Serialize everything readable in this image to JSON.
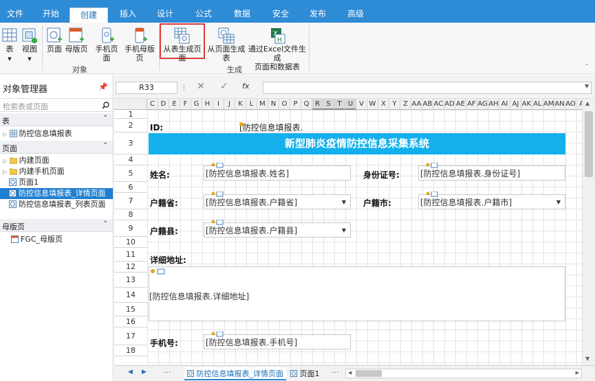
{
  "ribbon": {
    "tabs": [
      "文件",
      "开始",
      "创建",
      "插入",
      "设计",
      "公式",
      "数据",
      "安全",
      "发布",
      "高级"
    ],
    "active_tab": "创建",
    "buttons": {
      "table": "表",
      "view": "视图",
      "page": "页面",
      "master_page": "母版页",
      "mobile_page": "手机页面",
      "mobile_master_page": "手机母版页",
      "page_from_table": "从表生成页面",
      "table_from_page": "从页面生成表",
      "from_excel_line1": "通过Excel文件生成",
      "from_excel_line2": "页面和数据表"
    },
    "group_labels": {
      "objects": "对象",
      "generate": "生成"
    }
  },
  "left_panel": {
    "title": "对象管理器",
    "pin_icon": "pin-icon",
    "search_placeholder": "检索表或页面",
    "sections": {
      "tables": "表",
      "pages": "页面",
      "master_pages": "母版页"
    },
    "table_items": [
      "防控信息填报表"
    ],
    "page_items": [
      "内建页面",
      "内建手机页面",
      "页面1",
      "防控信息填报表_详情页面",
      "防控信息填报表_列表页面"
    ],
    "selected_page": "防控信息填报表_详情页面",
    "master_items": [
      "FGC_母版页"
    ]
  },
  "formula_bar": {
    "name_box": "R33",
    "fx": "fx"
  },
  "sheet": {
    "columns": [
      "C",
      "D",
      "E",
      "F",
      "G",
      "H",
      "I",
      "J",
      "K",
      "L",
      "M",
      "N",
      "O",
      "P",
      "Q",
      "R",
      "S",
      "T",
      "U",
      "V",
      "W",
      "X",
      "Y",
      "Z",
      "AA",
      "AB",
      "AC",
      "AD",
      "AE",
      "AF",
      "AG",
      "AH",
      "AI",
      "AJ",
      "AK",
      "AL",
      "AM",
      "AN",
      "AO",
      "A"
    ],
    "selected_columns": [
      "R",
      "S",
      "T",
      "U"
    ],
    "rows": [
      "1",
      "2",
      "3",
      "4",
      "5",
      "6",
      "7",
      "8",
      "9",
      "10",
      "11",
      "12",
      "13",
      "14",
      "15",
      "16",
      "17",
      "18"
    ],
    "id_label": "ID:",
    "id_binding": "[防控信息填报表.",
    "banner": "新型肺炎疫情防控信息采集系统",
    "labels": {
      "name": "姓名:",
      "id_card": "身份证号:",
      "province": "户籍省:",
      "city": "户籍市:",
      "county": "户籍县:",
      "address": "详细地址:",
      "phone": "手机号:"
    },
    "fields": {
      "name": "[防控信息填报表.姓名]",
      "id_card": "[防控信息填报表.身份证号]",
      "province": "[防控信息填报表.户籍省]",
      "city": "[防控信息填报表.户籍市]",
      "county": "[防控信息填报表.户籍县]",
      "address": "[防控信息填报表.详细地址]",
      "phone": "[防控信息填报表.手机号]"
    }
  },
  "bottom_bar": {
    "tabs": [
      "防控信息填报表_详情页面",
      "页面1"
    ],
    "active_tab": "防控信息填报表_详情页面",
    "ellipsis": "···"
  },
  "colors": {
    "accent": "#2e8bd6",
    "banner": "#14b0eb",
    "selected": "#1f7fd0",
    "highlight": "#e03b3b"
  }
}
